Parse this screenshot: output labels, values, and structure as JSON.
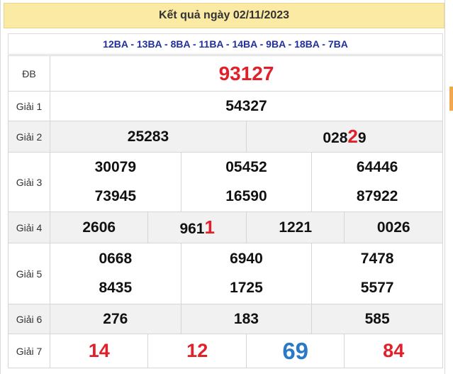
{
  "title": "Kết quả ngày 02/11/2023",
  "codes": "12BA - 13BA - 8BA - 11BA - 14BA - 9BA - 18BA - 7BA",
  "prizes": {
    "db": {
      "label": "ĐB",
      "value": "93127"
    },
    "g1": {
      "label": "Giải 1",
      "value": "54327"
    },
    "g2": {
      "label": "Giải 2",
      "a": "25283",
      "b_pre": "028",
      "b_hl": "2",
      "b_post": "9"
    },
    "g3": {
      "label": "Giải 3",
      "values": [
        "30079",
        "05452",
        "64446",
        "73945",
        "16590",
        "87922"
      ]
    },
    "g4": {
      "label": "Giải 4",
      "v1": "2606",
      "v2_pre": "961",
      "v2_hl": "1",
      "v3": "1221",
      "v4": "0026"
    },
    "g5": {
      "label": "Giải 5",
      "values": [
        "0668",
        "6940",
        "7478",
        "8435",
        "1725",
        "5577"
      ]
    },
    "g6": {
      "label": "Giải 6",
      "values": [
        "276",
        "183",
        "585"
      ]
    },
    "g7": {
      "label": "Giải 7",
      "values": [
        "14",
        "12",
        "69",
        "84"
      ]
    }
  },
  "colors": {
    "highlight": "#e0202a",
    "special_blue": "#2b79c6",
    "code_text": "#1f2f9e",
    "title_bg": "#fbeaa4"
  }
}
